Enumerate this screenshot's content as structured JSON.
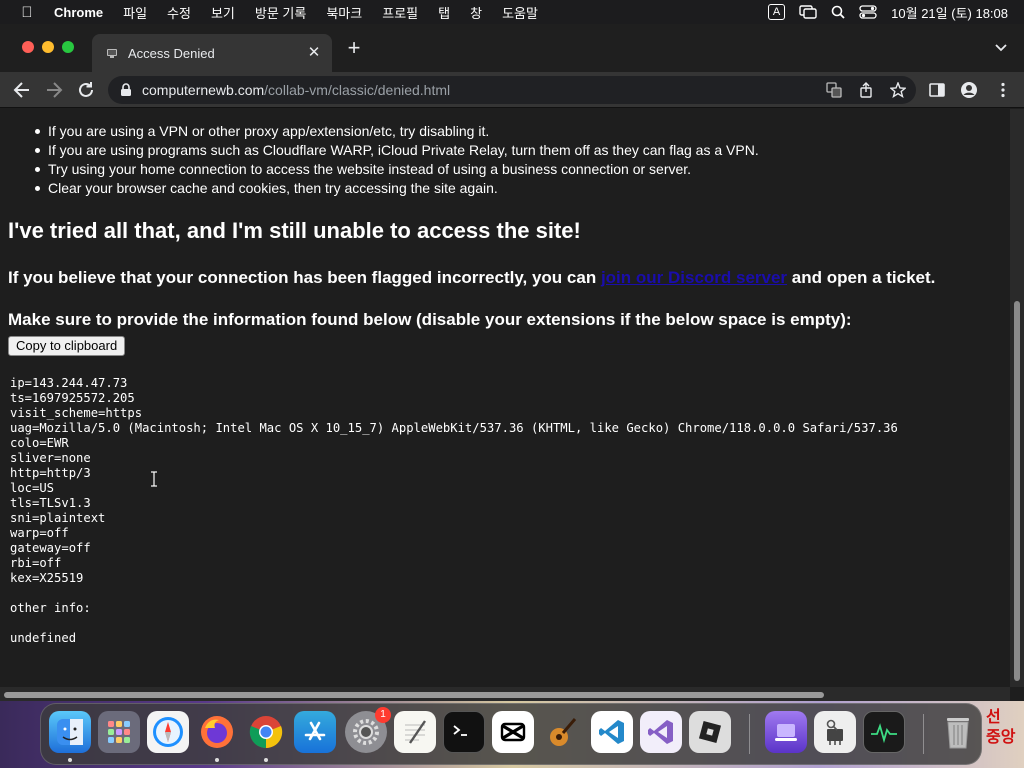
{
  "menubar": {
    "app_name": "Chrome",
    "items": [
      "파일",
      "수정",
      "보기",
      "방문 기록",
      "북마크",
      "프로필",
      "탭",
      "창",
      "도움말"
    ],
    "input_source": "A",
    "clock": "10월 21일 (토) 18:08"
  },
  "browser": {
    "tab_title": "Access Denied",
    "url_domain": "computernewb.com",
    "url_path": "/collab-vm/classic/denied.html"
  },
  "page": {
    "bullets": [
      "If you are using a VPN or other proxy app/extension/etc, try disabling it.",
      "If you are using programs such as Cloudflare WARP, iCloud Private Relay, turn them off as they can flag as a VPN.",
      "Try using your home connection to access the website instead of using a business connection or server.",
      "Clear your browser cache and cookies, then try accessing the site again."
    ],
    "heading": "I've tried all that, and I'm still unable to access the site!",
    "flagged_prefix": "If you believe that your connection has been flagged incorrectly, you can ",
    "discord_link": "join our Discord server",
    "flagged_suffix": " and open a ticket.",
    "provide_info": "Make sure to provide the information found below (disable your extensions if the below space is empty):",
    "copy_button": "Copy to clipboard",
    "trace_info": "ip=143.244.47.73\nts=1697925572.205\nvisit_scheme=https\nuag=Mozilla/5.0 (Macintosh; Intel Mac OS X 10_15_7) AppleWebKit/537.36 (KHTML, like Gecko) Chrome/118.0.0.0 Safari/537.36\ncolo=EWR\nsliver=none\nhttp=http/3\nloc=US\ntls=TLSv1.3\nsni=plaintext\nwarp=off\ngateway=off\nrbi=off\nkex=X25519\n\nother info:\n\nundefined"
  },
  "dock": {
    "system_preferences_badge": "1",
    "corner_text": "선\n중앙"
  }
}
